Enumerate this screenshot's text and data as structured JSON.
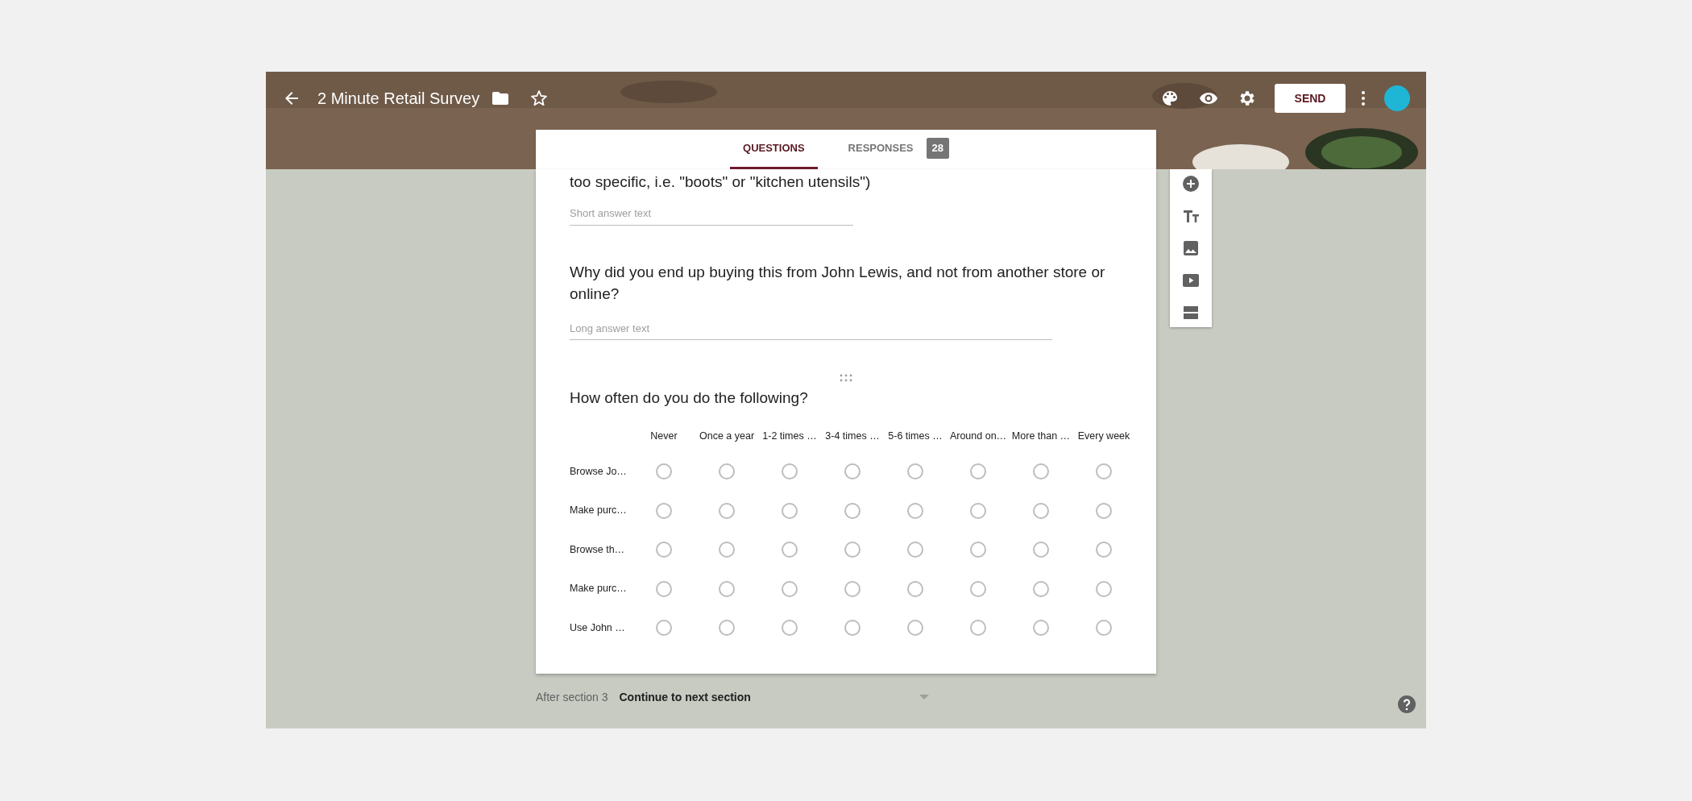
{
  "header": {
    "title": "2 Minute Retail Survey",
    "send_button": "SEND"
  },
  "tabs": [
    {
      "label": "QUESTIONS",
      "selected": true
    },
    {
      "label": "RESPONSES",
      "selected": false,
      "badge": "28"
    }
  ],
  "questions": [
    {
      "kind": "short",
      "title": "too specific, i.e. \"boots\" or \"kitchen utensils\")",
      "placeholder": "Short answer text"
    },
    {
      "kind": "long",
      "title": "Why did you end up buying this from John Lewis, and not from another store or online?",
      "placeholder": "Long answer text"
    },
    {
      "kind": "grid",
      "title": "How often do you do the following?",
      "columns": [
        "Never",
        "Once a year",
        "1-2 times …",
        "3-4 times …",
        "5-6 times …",
        "Around on…",
        "More than …",
        "Every week"
      ],
      "rows": [
        {
          "label": "Browse Jo…",
          "checked": [
            false,
            false,
            false,
            false,
            false,
            false,
            false,
            false
          ]
        },
        {
          "label": "Make purc…",
          "checked": [
            false,
            false,
            false,
            false,
            false,
            false,
            false,
            false
          ]
        },
        {
          "label": "Browse th…",
          "checked": [
            false,
            false,
            false,
            false,
            false,
            false,
            false,
            false
          ]
        },
        {
          "label": "Make purc…",
          "checked": [
            false,
            false,
            false,
            false,
            false,
            false,
            false,
            false
          ]
        },
        {
          "label": "Use John …",
          "checked": [
            false,
            false,
            false,
            false,
            false,
            false,
            false,
            false
          ]
        }
      ]
    }
  ],
  "after_section": {
    "label": "After section 3",
    "value": "Continue to next section"
  }
}
